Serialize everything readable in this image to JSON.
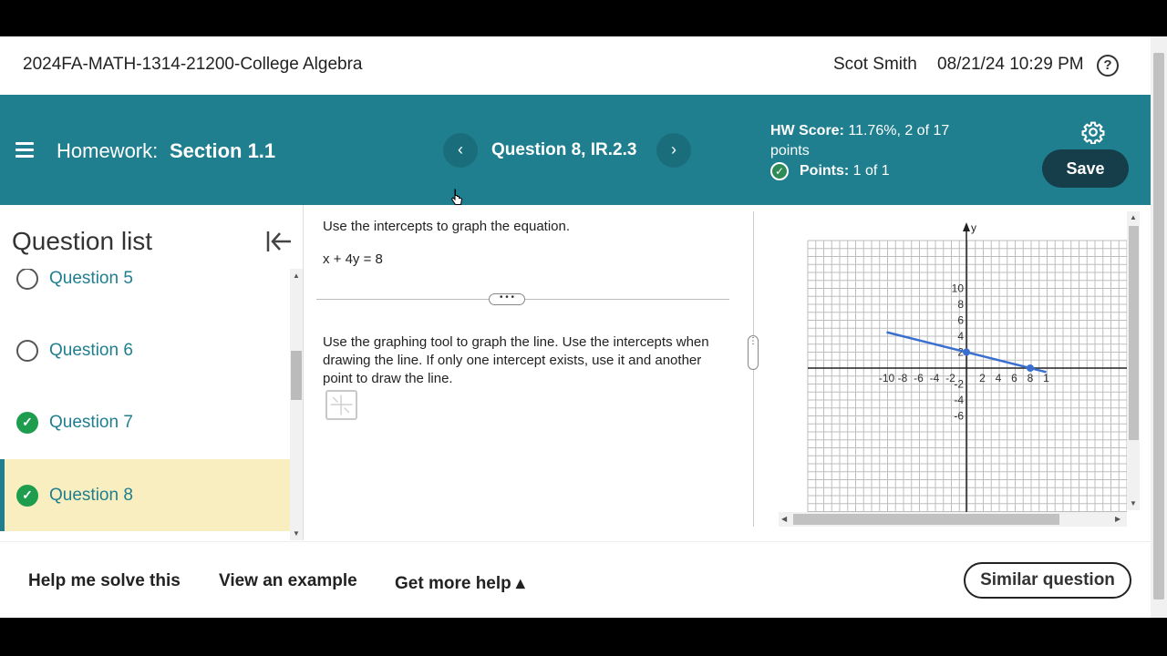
{
  "header": {
    "course_title": "2024FA-MATH-1314-21200-College Algebra",
    "user_name": "Scot Smith",
    "datetime": "08/21/24 10:29 PM",
    "help_icon": "?"
  },
  "nav": {
    "homework_label": "Homework:",
    "section_label": "Section 1.1",
    "prev_icon": "‹",
    "next_icon": "›",
    "question_title": "Question 8, IR.2.3",
    "hw_score_label": "HW Score:",
    "hw_score_value": "11.76%, 2 of 17 points",
    "points_label": "Points:",
    "points_value": "1 of 1",
    "save_label": "Save"
  },
  "question_list": {
    "title": "Question list",
    "items": [
      {
        "label": "Question 5",
        "status": "unanswered"
      },
      {
        "label": "Question 6",
        "status": "unanswered"
      },
      {
        "label": "Question 7",
        "status": "correct"
      },
      {
        "label": "Question 8",
        "status": "correct",
        "active": true
      }
    ]
  },
  "question": {
    "prompt": "Use the intercepts to graph the equation.",
    "equation": "x + 4y = 8",
    "divider_dots": "• • •",
    "instruction": "Use the graphing tool to graph the line. Use the intercepts when drawing the line. If only one intercept exists, use it and another point to draw the line."
  },
  "graph": {
    "x_axis_label": "",
    "y_axis_label": "y",
    "x_ticks": [
      "-10",
      "-8",
      "-6",
      "-4",
      "-2",
      "2",
      "4",
      "6",
      "8",
      "1"
    ],
    "y_ticks": [
      "10",
      "8",
      "6",
      "4",
      "2",
      "-2",
      "-4",
      "-6"
    ],
    "line_color": "#3a6fd0",
    "points": [
      {
        "x": 0,
        "y": 2
      },
      {
        "x": 8,
        "y": 0
      }
    ]
  },
  "bottom": {
    "help_solve": "Help me solve this",
    "view_example": "View an example",
    "more_help": "Get more help ▴",
    "similar_question": "Similar question"
  },
  "colors": {
    "nav_bg": "#1f7f8f",
    "save_bg": "#153d4a",
    "active_question_bg": "#f8eec0",
    "correct_green": "#1f9d4f"
  }
}
